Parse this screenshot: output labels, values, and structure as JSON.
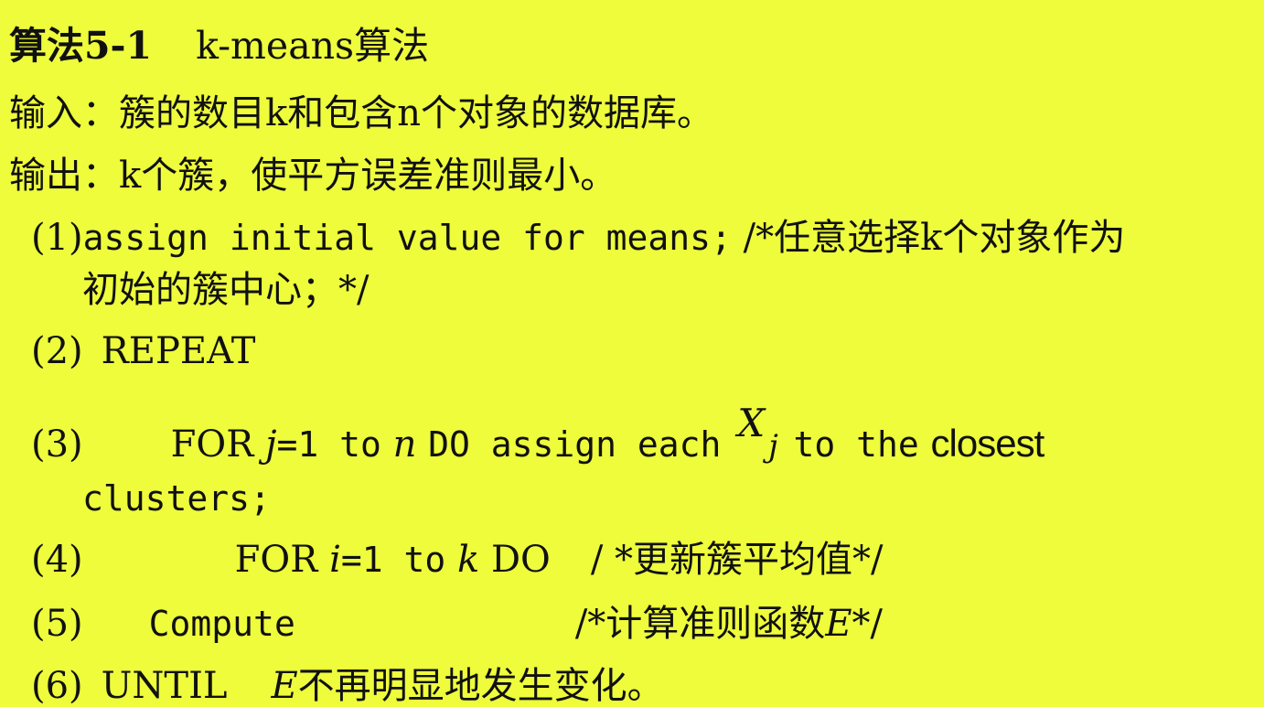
{
  "title": {
    "label": "算法5-1",
    "name": "k-means算法"
  },
  "input_line": "输入：簇的数目k和包含n个对象的数据库。",
  "output_line": "输出：k个簇，使平方误差准则最小。",
  "steps": [
    {
      "num": "(1)",
      "code": "assign initial value for means;",
      "comment": "/*任意选择k个对象作为",
      "continuation": "初始的簇中心；*/"
    },
    {
      "num": "(2)",
      "code": "REPEAT"
    },
    {
      "num": "(3)",
      "code_a": "FOR",
      "var_a": "j",
      "code_b": "=1 to",
      "var_b": "n",
      "code_c": "DO assign each",
      "x_symbol": "X",
      "x_sub": "j",
      "code_d": "to the",
      "emph": "closest",
      "continuation": "clusters;"
    },
    {
      "num": "(4)",
      "code_a": "FOR",
      "var_a": "i",
      "code_b": "=1 to",
      "var_b": "k",
      "code_c": "DO",
      "comment": "/ *更新簇平均值*/"
    },
    {
      "num": "(5)",
      "code": "Compute",
      "comment_a": "/*计算准则函数",
      "comment_var": "E",
      "comment_b": "*/"
    },
    {
      "num": "(6)",
      "code": "UNTIL",
      "var": "E",
      "text": "不再明显地发生变化。"
    }
  ]
}
